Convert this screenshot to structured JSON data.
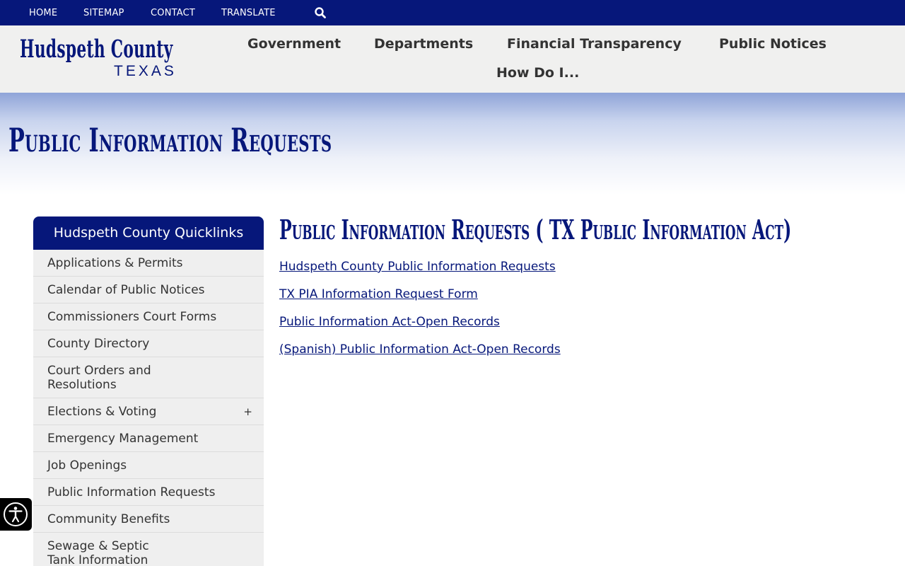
{
  "utility_nav": {
    "items": [
      "HOME",
      "SITEMAP",
      "CONTACT",
      "TRANSLATE"
    ],
    "search_icon": "search-icon"
  },
  "logo": {
    "main": "Hudspeth County",
    "sub": "TEXAS"
  },
  "main_nav": {
    "items": [
      "Government",
      "Departments",
      "Financial Transparency",
      "Public Notices",
      "How Do I..."
    ]
  },
  "hero": {
    "title": "Public Information Requests"
  },
  "sidebar": {
    "title": "Hudspeth County Quicklinks",
    "items": [
      {
        "label": "Applications & Permits"
      },
      {
        "label": "Calendar of Public Notices"
      },
      {
        "label": "Commissioners Court Forms"
      },
      {
        "label": "County Directory"
      },
      {
        "label": "Court Orders and Resolutions"
      },
      {
        "label": "Elections & Voting",
        "expand": "+"
      },
      {
        "label": "Emergency Management"
      },
      {
        "label": "Job Openings"
      },
      {
        "label": "Public Information Requests"
      },
      {
        "label": "Community Benefits"
      },
      {
        "label": "Sewage & Septic Tank Information"
      }
    ]
  },
  "content": {
    "heading": "Public Information Requests (  TX Public Information Act)",
    "links": [
      "Hudspeth County Public Information Requests",
      "TX PIA Information Request Form",
      "Public Information Act-Open Records",
      "(Spanish) Public Information Act-Open Records"
    ]
  },
  "accessibility": {
    "icon": "accessibility-icon"
  },
  "colors": {
    "brand_navy": "#06177a",
    "header_bg": "#f0f0ef",
    "sidebar_item_bg": "#efefef"
  }
}
